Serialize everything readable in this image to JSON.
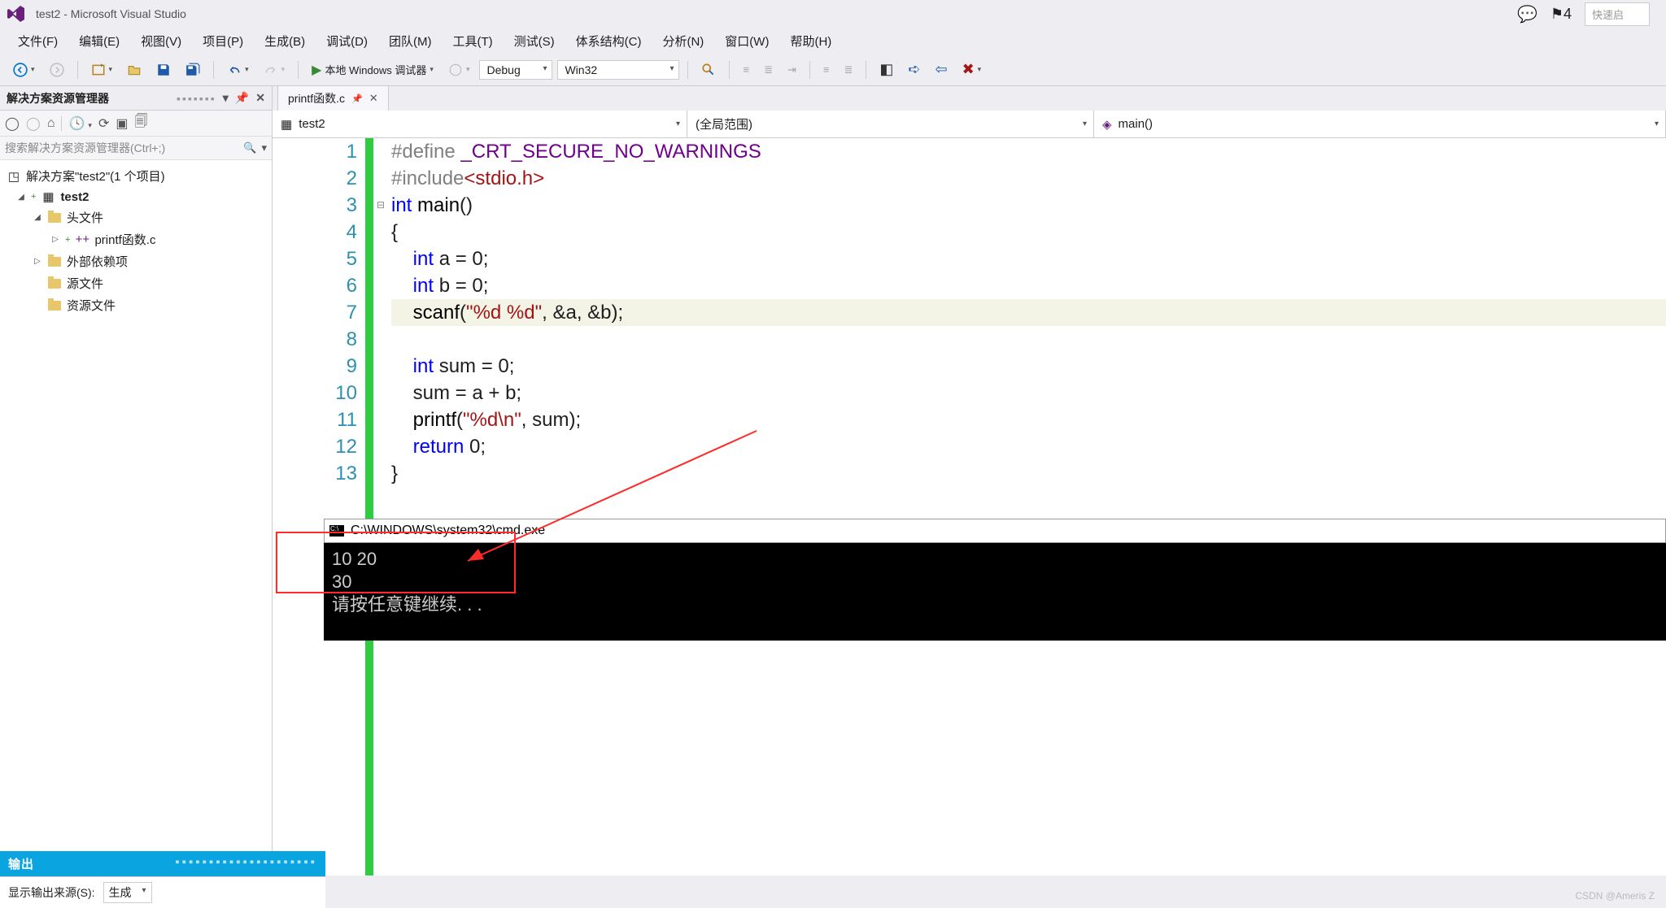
{
  "titlebar": {
    "title": "test2 - Microsoft Visual Studio",
    "notif_count": "4",
    "quicklaunch_placeholder": "快速启"
  },
  "menu": {
    "file": "文件(F)",
    "edit": "编辑(E)",
    "view": "视图(V)",
    "project": "项目(P)",
    "build": "生成(B)",
    "debug": "调试(D)",
    "team": "团队(M)",
    "tools": "工具(T)",
    "test": "测试(S)",
    "arch": "体系结构(C)",
    "analyze": "分析(N)",
    "window": "窗口(W)",
    "help": "帮助(H)"
  },
  "toolbar": {
    "debugger": "本地 Windows 调试器",
    "config": "Debug",
    "platform": "Win32"
  },
  "solution_explorer": {
    "title": "解决方案资源管理器",
    "search_placeholder": "搜索解决方案资源管理器(Ctrl+;)",
    "root": "解决方案\"test2\"(1 个项目)",
    "project": "test2",
    "headers": "头文件",
    "file": "printf函数.c",
    "external": "外部依赖项",
    "source": "源文件",
    "resource": "资源文件"
  },
  "editor": {
    "tab": "printf函数.c",
    "nav1": "test2",
    "nav2": "(全局范围)",
    "nav3": "main()",
    "lines": {
      "l1a": "#define ",
      "l1b": "_CRT_SECURE_NO_WARNINGS",
      "l2a": "#include",
      "l2b": "<stdio.h>",
      "l3a": "int ",
      "l3b": "main",
      "l3c": "()",
      "l4": "{",
      "l5a": "    int ",
      "l5b": "a = 0;",
      "l6a": "    int ",
      "l6b": "b = 0;",
      "l7a": "    scanf",
      "l7b": "(",
      "l7c": "\"%d %d\"",
      "l7d": ", &a, &b);",
      "l8": "",
      "l9a": "    int ",
      "l9b": "sum = 0;",
      "l10": "    sum = a + b;",
      "l11a": "    printf",
      "l11b": "(",
      "l11c": "\"%d\\n\"",
      "l11d": ", sum);",
      "l12a": "    return ",
      "l12b": "0;",
      "l13": "}"
    },
    "linenums": [
      "1",
      "2",
      "3",
      "4",
      "5",
      "6",
      "7",
      "8",
      "9",
      "10",
      "11",
      "12",
      "13"
    ]
  },
  "console": {
    "title": "C:\\WINDOWS\\system32\\cmd.exe",
    "l1": "10 20",
    "l2": "30",
    "l3": "请按任意键继续. . ."
  },
  "output": {
    "title": "输出",
    "src_label": "显示输出来源(S):",
    "src_value": "生成"
  },
  "watermark": "CSDN @Ameris Z"
}
